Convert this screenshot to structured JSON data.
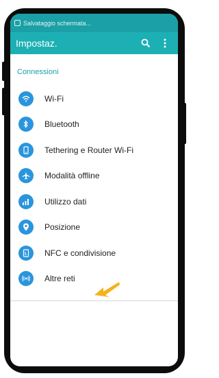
{
  "status_bar": {
    "notification_text": "Salvataggio schermata..."
  },
  "app_bar": {
    "title": "Impostaz.",
    "search_icon": "search-icon",
    "menu_icon": "overflow-menu-icon"
  },
  "section": {
    "header": "Connessioni"
  },
  "items": [
    {
      "label": "Wi-Fi",
      "icon": "wifi-icon"
    },
    {
      "label": "Bluetooth",
      "icon": "bluetooth-icon"
    },
    {
      "label": "Tethering e Router Wi-Fi",
      "icon": "tethering-icon"
    },
    {
      "label": "Modalità offline",
      "icon": "airplane-icon"
    },
    {
      "label": "Utilizzo dati",
      "icon": "data-usage-icon"
    },
    {
      "label": "Posizione",
      "icon": "location-icon"
    },
    {
      "label": "NFC e condivisione",
      "icon": "nfc-icon"
    },
    {
      "label": "Altre reti",
      "icon": "more-networks-icon"
    }
  ],
  "colors": {
    "primary": "#1cb0b4",
    "accent_icon": "#2a95dc",
    "arrow": "#f5b21b"
  }
}
